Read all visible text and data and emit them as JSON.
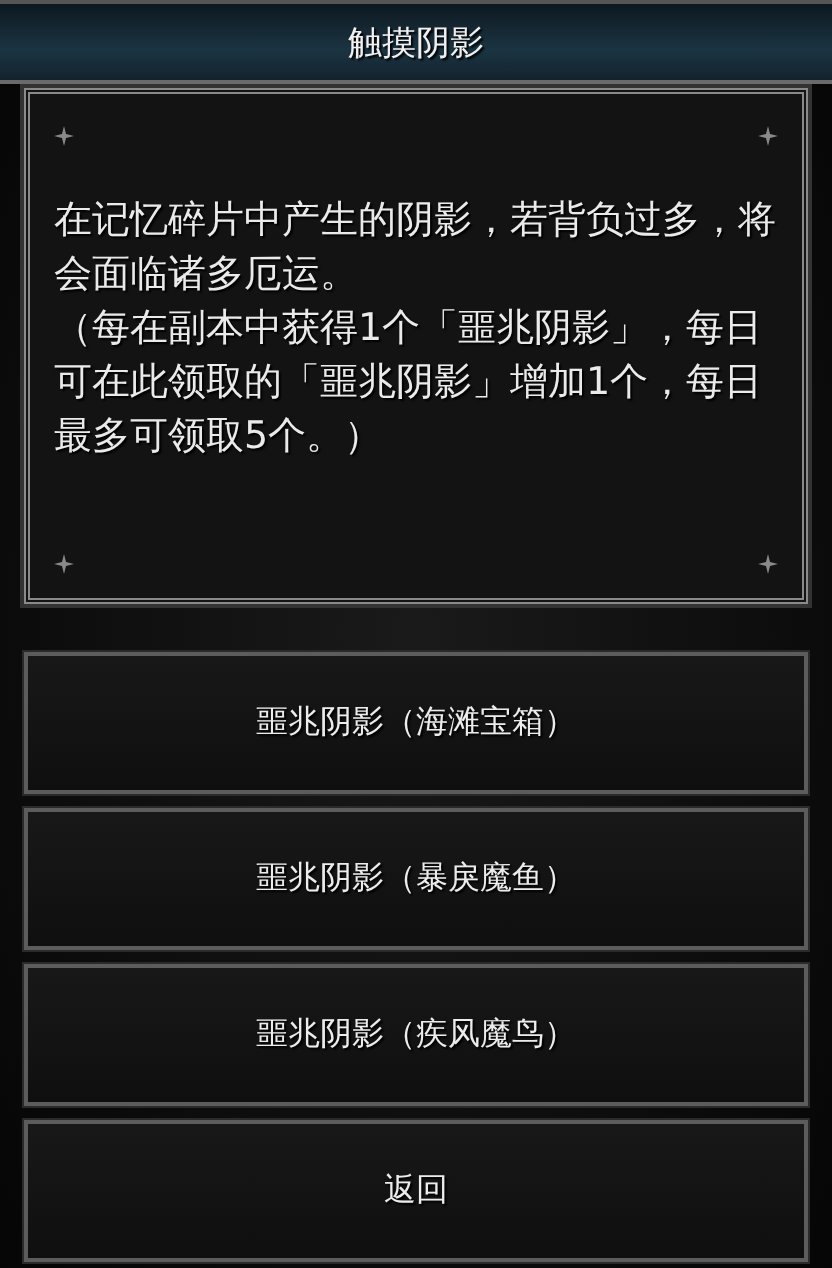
{
  "window": {
    "title": "触摸阴影"
  },
  "description": [
    "在记忆碎片中产生的阴影，若背负过多，将会面临诸多厄运。",
    "（每在副本中获得1个「噩兆阴影」，每日可在此领取的「噩兆阴影」增加1个，每日最多可领取5个。）"
  ],
  "buttons": [
    "噩兆阴影（海滩宝箱）",
    "噩兆阴影（暴戾魔鱼）",
    "噩兆阴影（疾风魔鸟）",
    "返回"
  ]
}
